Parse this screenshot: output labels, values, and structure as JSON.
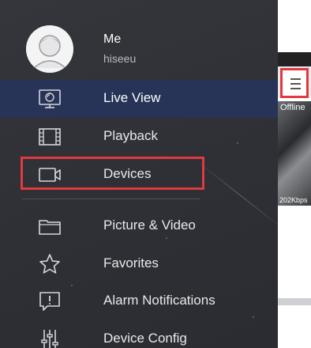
{
  "profile": {
    "name": "Me",
    "account": "hiseeu"
  },
  "menu": {
    "items": [
      {
        "label": "Live View",
        "icon": "monitor-icon",
        "active": true
      },
      {
        "label": "Playback",
        "icon": "film-strip-icon",
        "active": false
      },
      {
        "label": "Devices",
        "icon": "camera-icon",
        "active": false,
        "highlighted": true
      },
      {
        "label": "Picture & Video",
        "icon": "folder-icon",
        "active": false
      },
      {
        "label": "Favorites",
        "icon": "star-icon",
        "active": false
      },
      {
        "label": "Alarm Notifications",
        "icon": "alert-message-icon",
        "active": false
      },
      {
        "label": "Device Config",
        "icon": "sliders-icon",
        "active": false
      }
    ]
  },
  "background_app": {
    "camera_status": "Offline",
    "bitrate": "202Kbps"
  },
  "colors": {
    "drawer_bg": "#2e3036",
    "active_item_bg": "#273357",
    "highlight_border": "#e03a3f"
  }
}
